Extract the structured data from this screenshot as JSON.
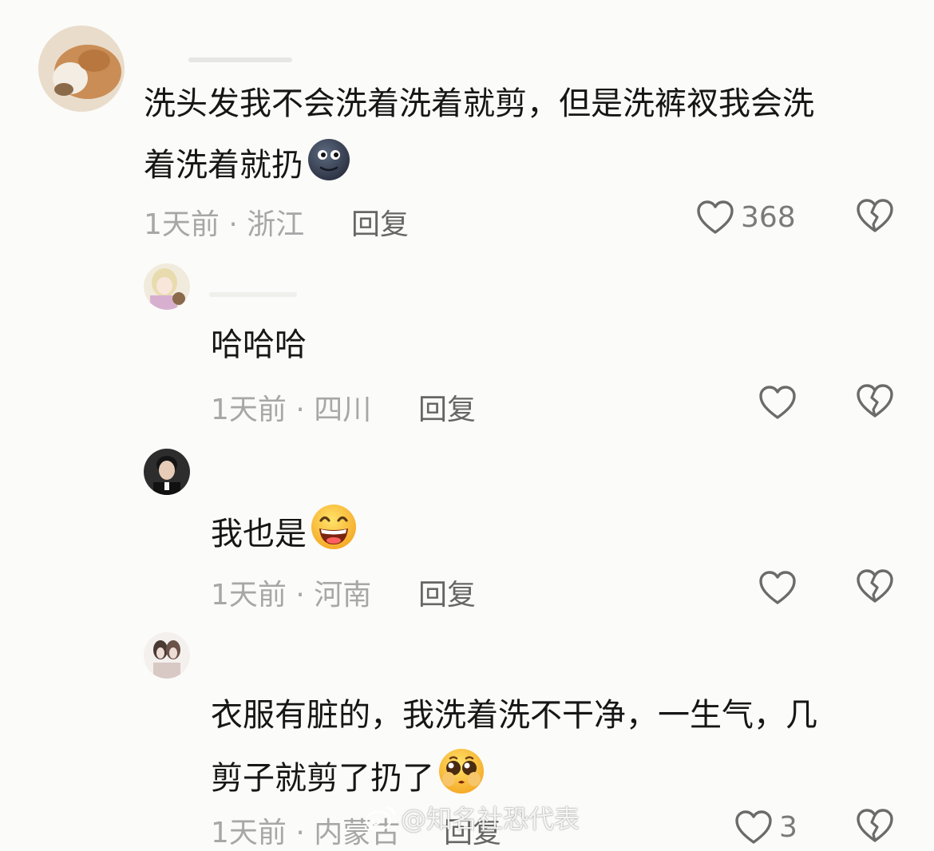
{
  "comments": [
    {
      "text_lines": [
        "洗头发我不会洗着洗着就剪，但是洗裤衩我会洗",
        "着洗着就扔"
      ],
      "emoji": "new-moon-face",
      "meta": "1天前 · 浙江",
      "reply": "回复",
      "likes": "368"
    },
    {
      "text_lines": [
        "哈哈哈"
      ],
      "meta": "1天前 · 四川",
      "reply": "回复",
      "likes": ""
    },
    {
      "text_lines": [
        "我也是"
      ],
      "emoji": "grinning-face",
      "meta": "1天前 · 河南",
      "reply": "回复",
      "likes": ""
    },
    {
      "text_lines": [
        "衣服有脏的，我洗着洗不干净，一生气，几",
        "剪子就剪了扔了"
      ],
      "emoji": "pleading-face",
      "meta": "1天前 · 内蒙古",
      "reply": "回复",
      "likes": "3"
    }
  ],
  "watermark": "@知名社恐代表",
  "colors": {
    "background": "#fbfbf9",
    "text": "#161616",
    "meta": "#a7a7a7",
    "icon": "#6b6b6b"
  }
}
